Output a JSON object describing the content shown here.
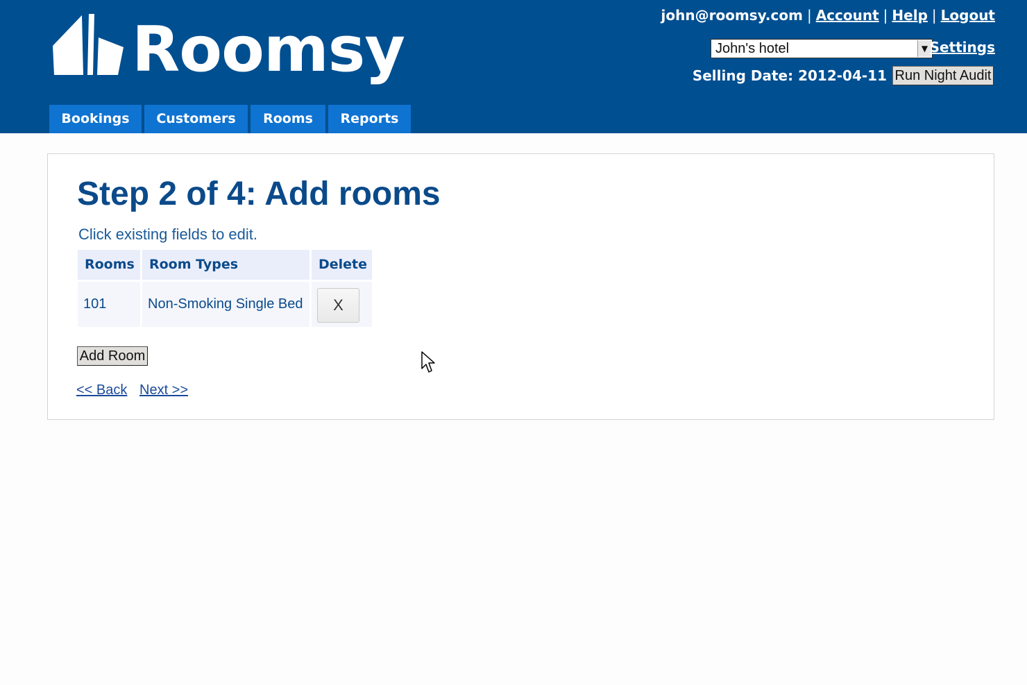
{
  "header": {
    "brand": "Roomsy",
    "user_email": "john@roomsy.com",
    "links": {
      "account": "Account",
      "help": "Help",
      "logout": "Logout",
      "settings": "Settings"
    },
    "separator": "|",
    "hotel_select": {
      "selected": "John's hotel"
    },
    "selling_date_label": "Selling Date: 2012-04-11",
    "run_night_audit": "Run Night Audit",
    "brand_color": "#004f91",
    "tab_color": "#0f73d1"
  },
  "nav": {
    "tabs": [
      {
        "label": "Bookings"
      },
      {
        "label": "Customers"
      },
      {
        "label": "Rooms"
      },
      {
        "label": "Reports"
      }
    ]
  },
  "main": {
    "title": "Step 2 of 4: Add rooms",
    "hint": "Click existing fields to edit.",
    "table": {
      "columns": [
        "Rooms",
        "Room Types",
        "Delete"
      ],
      "rows": [
        {
          "room": "101",
          "room_type": "Non-Smoking Single Bed",
          "delete_label": "X"
        }
      ]
    },
    "add_room_label": "Add Room",
    "back_label": "<< Back",
    "next_label": "Next >>"
  },
  "icons": {
    "logo": "roomsy-logo-icon",
    "dropdown": "chevron-down-icon",
    "cursor": "mouse-pointer-icon"
  }
}
